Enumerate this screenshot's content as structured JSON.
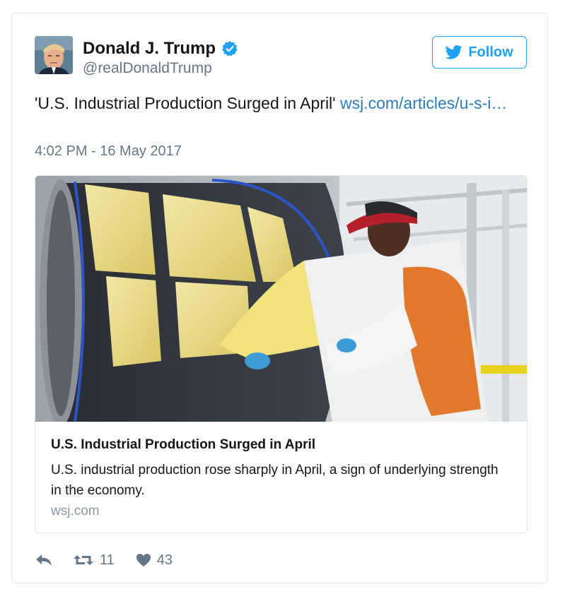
{
  "author": {
    "display_name": "Donald J. Trump",
    "screen_name": "@realDonaldTrump",
    "verified": true
  },
  "follow_button": {
    "label": "Follow"
  },
  "tweet": {
    "text": "'U.S. Industrial Production Surged in April' ",
    "link_text": "wsj.com/articles/u-s-i…",
    "timestamp": "4:02 PM - 16 May 2017"
  },
  "card": {
    "title": "U.S. Industrial Production Surged in April",
    "description": "U.S. industrial production rose sharply in April, a sign of underlying strength in the economy.",
    "domain": "wsj.com"
  },
  "actions": {
    "retweet_count": "11",
    "like_count": "43"
  },
  "colors": {
    "accent": "#1da1f2",
    "link": "#2b7bb9",
    "secondary_text": "#657786",
    "border": "#e1e8ed"
  },
  "icons": {
    "verified": "verified-badge-icon",
    "follow": "twitter-bird-icon",
    "reply": "reply-arrow-icon",
    "retweet": "retweet-icon",
    "like": "heart-icon"
  }
}
